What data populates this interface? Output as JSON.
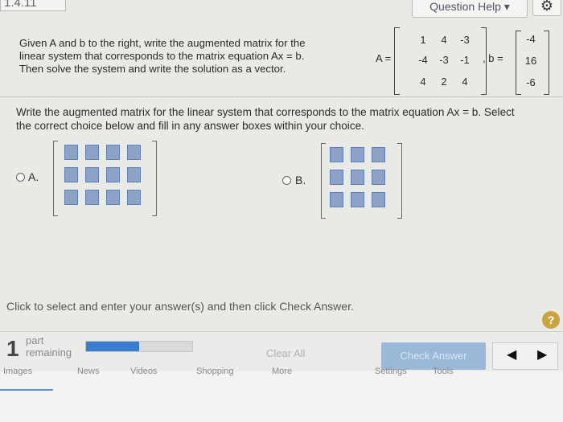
{
  "header": {
    "section_label": "1.4.11",
    "question_help": "Question Help ▾",
    "gear_icon": "gear-icon"
  },
  "intro": {
    "line1": "Given A and b to the right, write the augmented matrix for the",
    "line2": "linear system that corresponds to the matrix equation Ax = b.",
    "line3": "Then solve the system and write the solution as a vector."
  },
  "matrixA": {
    "label": "A =",
    "rows": [
      [
        "1",
        "4",
        "-3"
      ],
      [
        "-4",
        "-3",
        "-1"
      ],
      [
        "4",
        "2",
        "4"
      ]
    ]
  },
  "vectorB": {
    "label": ", b =",
    "values": [
      "-4",
      "16",
      "-6"
    ]
  },
  "instructions": {
    "line1": "Write the augmented matrix for the linear system that corresponds to the matrix equation Ax = b. Select",
    "line2": "the correct choice below and fill in any answer boxes within your choice."
  },
  "choices": [
    {
      "label": "A.",
      "rows": 3,
      "cols": 4
    },
    {
      "label": "B.",
      "rows": 3,
      "cols": 3
    }
  ],
  "footer": {
    "hint": "Click to select and enter your answer(s) and then click Check Answer.",
    "help": "?",
    "part_number": "1",
    "part_line1": "part",
    "part_line2": "remaining",
    "progress": 0.5,
    "clear_all": "Clear All",
    "check_answer": "Check Answer",
    "prev": "◀",
    "next": "▶"
  },
  "browser_bar": {
    "items": [
      "Images",
      "News",
      "Videos",
      "Shopping",
      "More",
      "Settings",
      "Tools"
    ]
  }
}
